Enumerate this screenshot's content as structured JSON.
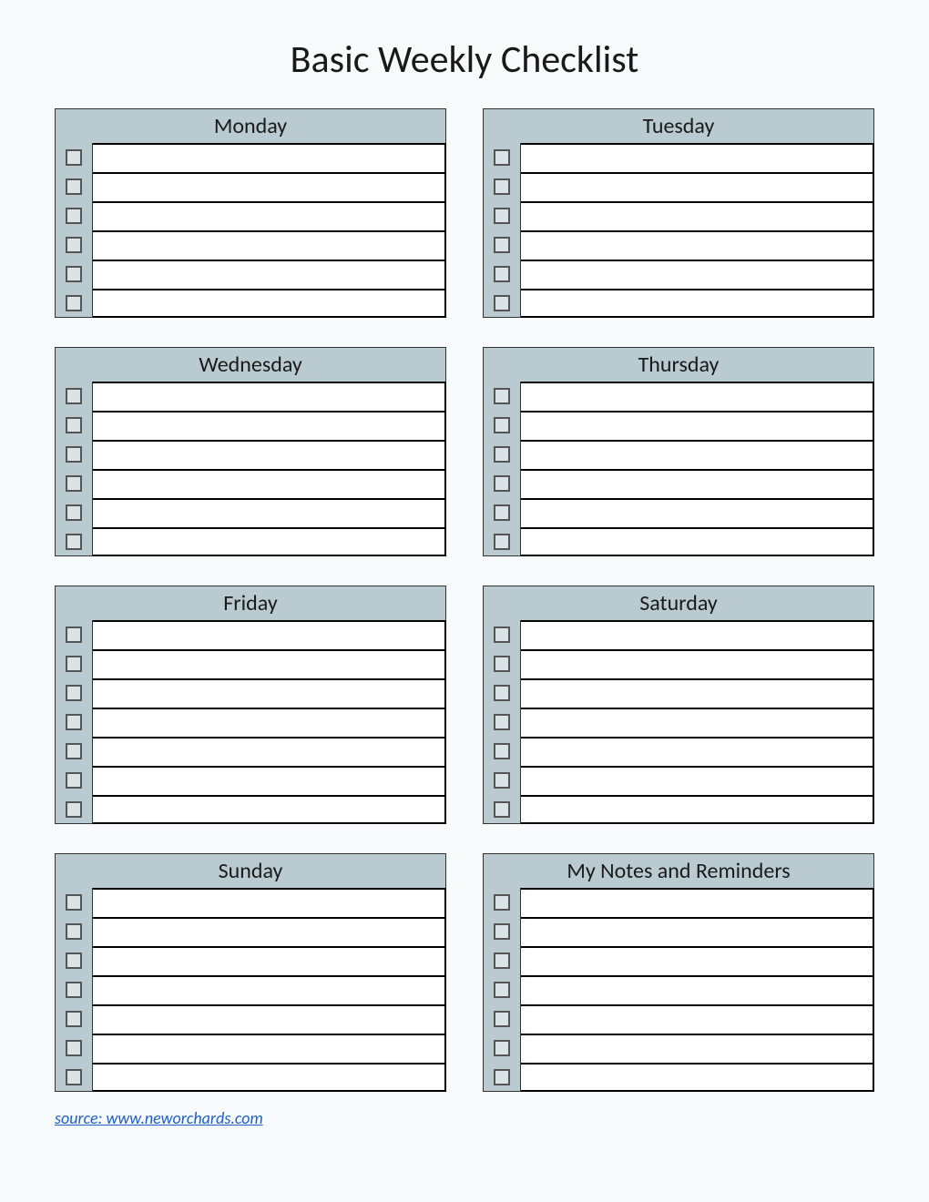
{
  "title": "Basic Weekly Checklist",
  "sections": [
    {
      "label": "Monday",
      "rows": 6
    },
    {
      "label": "Tuesday",
      "rows": 6
    },
    {
      "label": "Wednesday",
      "rows": 6
    },
    {
      "label": "Thursday",
      "rows": 6
    },
    {
      "label": "Friday",
      "rows": 7
    },
    {
      "label": "Saturday",
      "rows": 7
    },
    {
      "label": "Sunday",
      "rows": 7
    },
    {
      "label": "My Notes and Reminders",
      "rows": 7
    }
  ],
  "source": "source: www.neworchards.com"
}
